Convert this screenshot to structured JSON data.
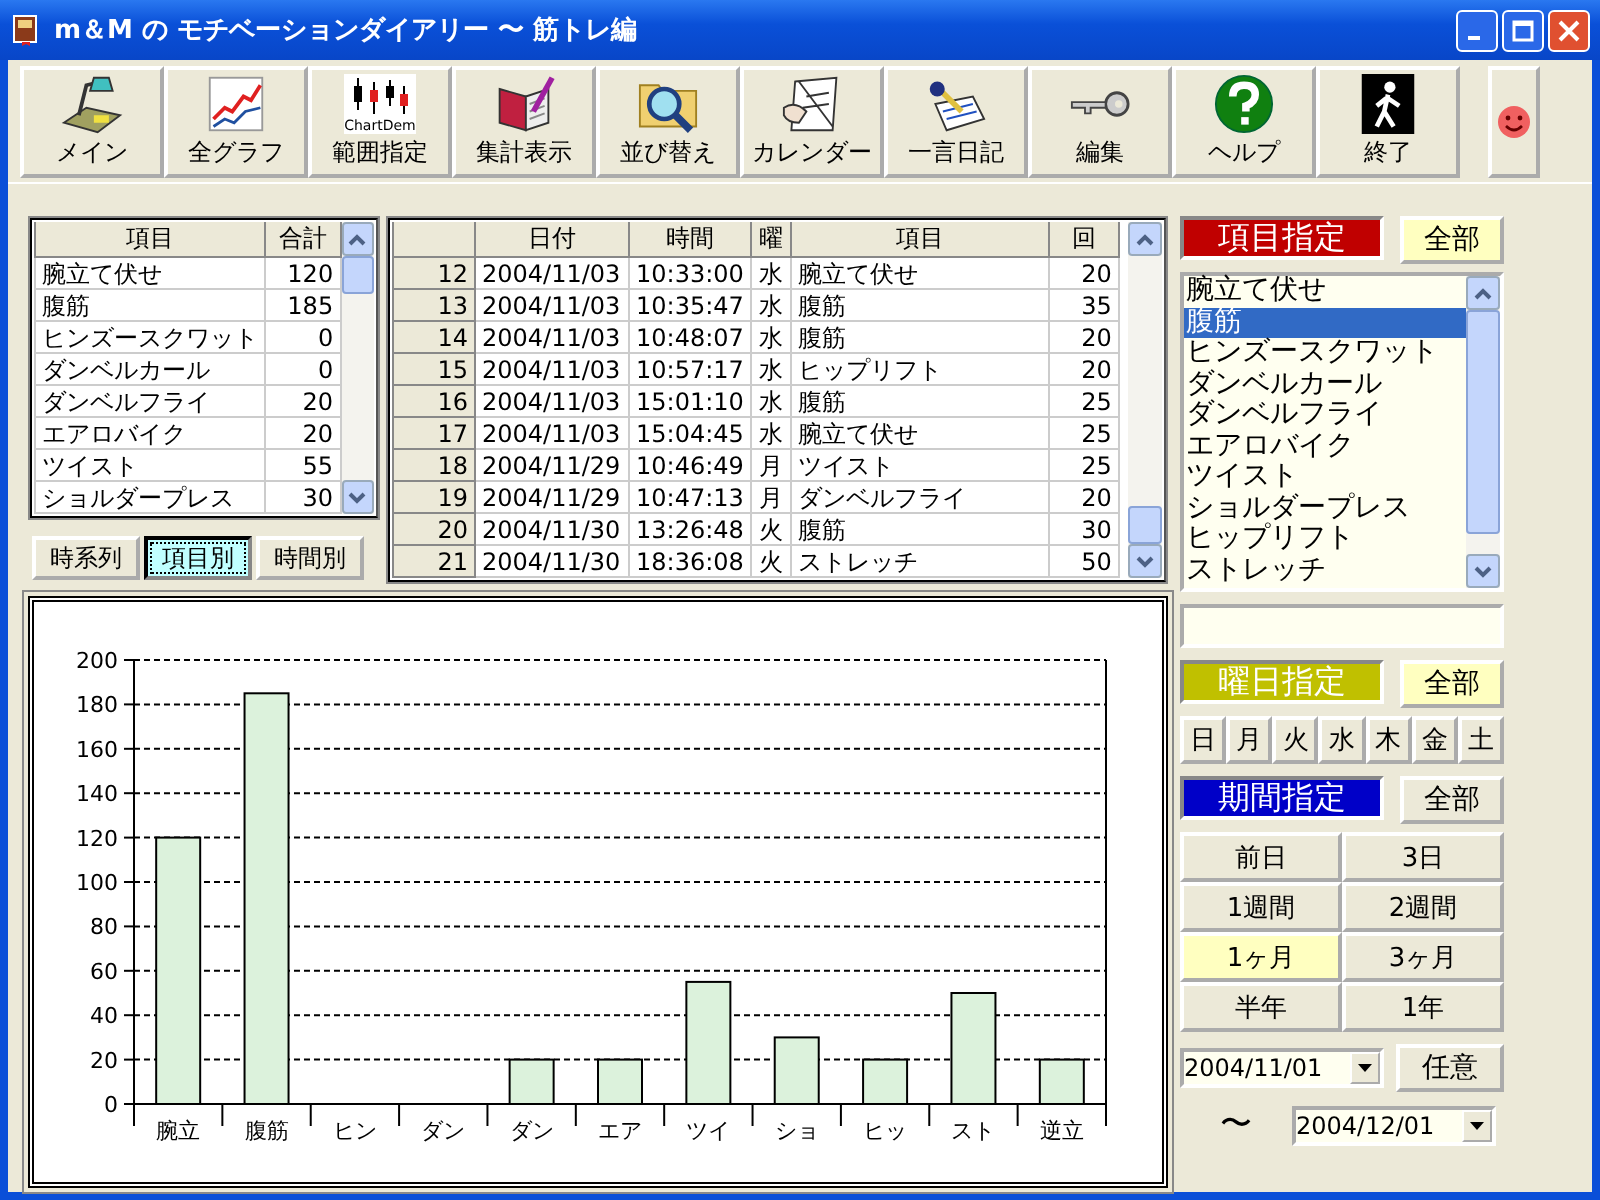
{
  "window": {
    "title": "m＆M の モチベーションダイアリー 〜 筋トレ編"
  },
  "toolbar": [
    {
      "label": "メイン"
    },
    {
      "label": "全グラフ"
    },
    {
      "label": "範囲指定",
      "icon_text": "ChartDem"
    },
    {
      "label": "集計表示"
    },
    {
      "label": "並び替え"
    },
    {
      "label": "カレンダー"
    },
    {
      "label": "一言日記"
    },
    {
      "label": "編集"
    },
    {
      "label": "ヘルプ"
    },
    {
      "label": "終了"
    }
  ],
  "totals_table": {
    "columns": [
      "項目",
      "合計"
    ],
    "rows": [
      [
        "腕立て伏せ",
        "120"
      ],
      [
        "腹筋",
        "185"
      ],
      [
        "ヒンズースクワット",
        "0"
      ],
      [
        "ダンベルカール",
        "0"
      ],
      [
        "ダンベルフライ",
        "20"
      ],
      [
        "エアロバイク",
        "20"
      ],
      [
        "ツイスト",
        "55"
      ],
      [
        "ショルダープレス",
        "30"
      ]
    ]
  },
  "view_tabs": [
    {
      "label": "時系列",
      "selected": false
    },
    {
      "label": "項目別",
      "selected": true
    },
    {
      "label": "時間別",
      "selected": false
    }
  ],
  "log_table": {
    "columns": [
      "",
      "日付",
      "時間",
      "曜",
      "項目",
      "回"
    ],
    "rows": [
      [
        "12",
        "2004/11/03",
        "10:33:00",
        "水",
        "腕立て伏せ",
        "20"
      ],
      [
        "13",
        "2004/11/03",
        "10:35:47",
        "水",
        "腹筋",
        "35"
      ],
      [
        "14",
        "2004/11/03",
        "10:48:07",
        "水",
        "腹筋",
        "20"
      ],
      [
        "15",
        "2004/11/03",
        "10:57:17",
        "水",
        "ヒップリフト",
        "20"
      ],
      [
        "16",
        "2004/11/03",
        "15:01:10",
        "水",
        "腹筋",
        "25"
      ],
      [
        "17",
        "2004/11/03",
        "15:04:45",
        "水",
        "腕立て伏せ",
        "25"
      ],
      [
        "18",
        "2004/11/29",
        "10:46:49",
        "月",
        "ツイスト",
        "25"
      ],
      [
        "19",
        "2004/11/29",
        "10:47:13",
        "月",
        "ダンベルフライ",
        "20"
      ],
      [
        "20",
        "2004/11/30",
        "13:26:48",
        "火",
        "腹筋",
        "30"
      ],
      [
        "21",
        "2004/11/30",
        "18:36:08",
        "火",
        "ストレッチ",
        "50"
      ]
    ]
  },
  "chart": {
    "chart_data": {
      "type": "bar",
      "categories": [
        "腕立",
        "腹筋",
        "ヒン",
        "ダン",
        "ダン",
        "エア",
        "ツイ",
        "ショ",
        "ヒッ",
        "スト",
        "逆立"
      ],
      "series": [
        {
          "color": "#dcf2dc",
          "values": [
            120,
            185,
            0,
            0,
            20,
            20,
            55,
            30,
            20,
            50,
            20
          ]
        }
      ],
      "grid": true,
      "ylim": [
        0,
        200
      ],
      "yticks": [
        0,
        20,
        40,
        60,
        80,
        100,
        120,
        140,
        160,
        180,
        200
      ]
    }
  },
  "item_filter": {
    "header": {
      "label": "項目指定",
      "color": "#c00000"
    },
    "all_button": {
      "label": "全部",
      "selected": true
    },
    "items": [
      {
        "label": "腕立て伏せ",
        "selected": false
      },
      {
        "label": "腹筋",
        "selected": true
      },
      {
        "label": "ヒンズースクワット",
        "selected": false
      },
      {
        "label": "ダンベルカール",
        "selected": false
      },
      {
        "label": "ダンベルフライ",
        "selected": false
      },
      {
        "label": "エアロバイク",
        "selected": false
      },
      {
        "label": "ツイスト",
        "selected": false
      },
      {
        "label": "ショルダープレス",
        "selected": false
      },
      {
        "label": "ヒップリフト",
        "selected": false
      },
      {
        "label": "ストレッチ",
        "selected": false
      }
    ]
  },
  "weekday_filter": {
    "header": {
      "label": "曜日指定",
      "color": "#c0c000"
    },
    "all_button": {
      "label": "全部",
      "selected": true
    },
    "days": [
      {
        "label": "日",
        "selected": false
      },
      {
        "label": "月",
        "selected": false
      },
      {
        "label": "火",
        "selected": false
      },
      {
        "label": "水",
        "selected": false
      },
      {
        "label": "木",
        "selected": false
      },
      {
        "label": "金",
        "selected": false
      },
      {
        "label": "土",
        "selected": false
      }
    ]
  },
  "period_filter": {
    "header": {
      "label": "期間指定",
      "color": "#0000c8"
    },
    "all_button": {
      "label": "全部",
      "selected": false
    },
    "periods": [
      {
        "label": "前日",
        "selected": false
      },
      {
        "label": "3日",
        "selected": false
      },
      {
        "label": "1週間",
        "selected": false
      },
      {
        "label": "2週間",
        "selected": false
      },
      {
        "label": "1ヶ月",
        "selected": true
      },
      {
        "label": "3ヶ月",
        "selected": false
      },
      {
        "label": "半年",
        "selected": false
      },
      {
        "label": "1年",
        "selected": false
      }
    ],
    "from_date": "2004/11/01",
    "custom_button": "任意",
    "separator": "〜",
    "to_date": "2004/12/01"
  }
}
